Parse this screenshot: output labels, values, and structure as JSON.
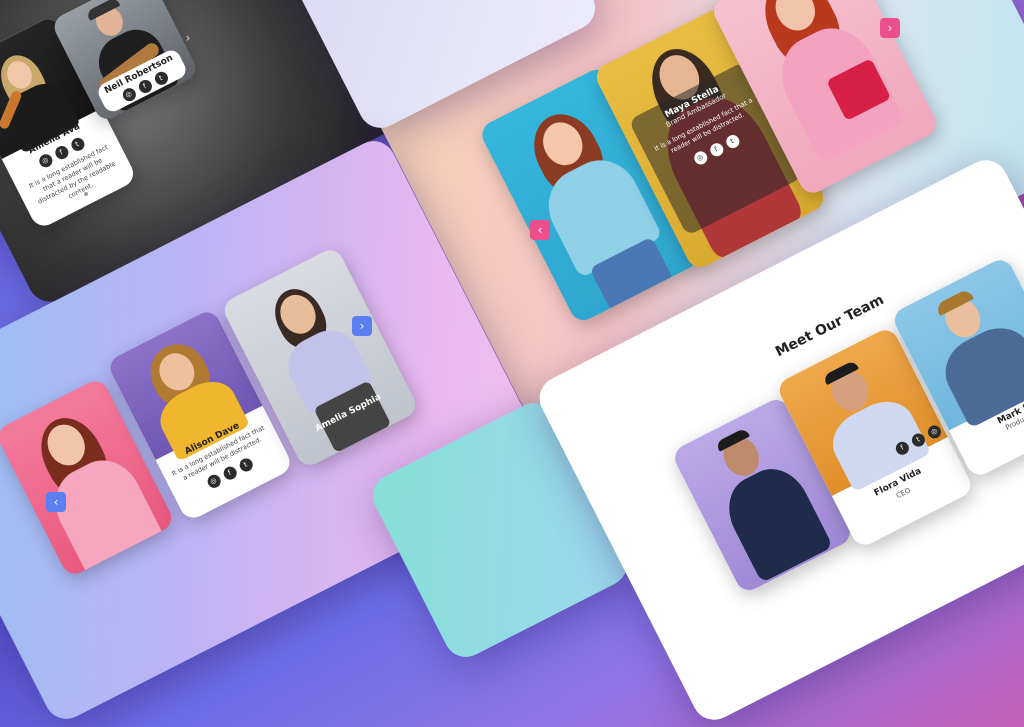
{
  "panels": {
    "top_left": {
      "cards": [
        {
          "name": "Amelia Ava",
          "text": "It is a long established fact that a reader will be distracted by the readable content."
        },
        {
          "name": "Neil Robertson"
        }
      ],
      "next_arrow": "›"
    },
    "top_right": {
      "cards": [
        {
          "name": "Maya Stella",
          "role": "Brand Ambassador",
          "text": "It is a long established fact that a reader will be distracted."
        }
      ],
      "prev_arrow": "‹",
      "next_arrow": "›"
    },
    "bottom_left": {
      "cards": [
        {
          "name": "Alison Dave",
          "text": "It is a long established fact that a reader will be distracted."
        },
        {
          "name": "Amelia Sophia"
        }
      ],
      "prev_arrow": "‹",
      "next_arrow": "›"
    },
    "bottom_right": {
      "title": "Meet Our Team",
      "cards": [
        {
          "name": "Flora Vida",
          "role": "CEO"
        },
        {
          "name": "Mark S",
          "role": "Product"
        }
      ]
    }
  },
  "icons": {
    "facebook": "f",
    "instagram": "◎",
    "twitter": "t"
  },
  "colors": {
    "arrow_pink": "#ec4f8c",
    "arrow_blue": "#5b7ef0"
  }
}
